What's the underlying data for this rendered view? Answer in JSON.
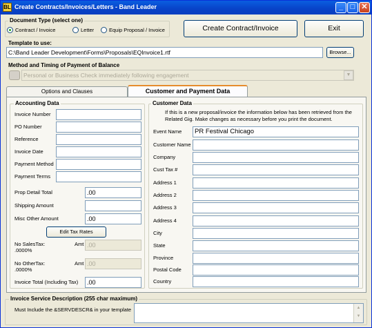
{
  "window": {
    "title": "Create Contracts/Invoices/Letters - Band Leader",
    "min": "_",
    "max": "□",
    "close": "✕"
  },
  "doc_type": {
    "label": "Document Type (select one)",
    "options": [
      "Contract / Invoice",
      "Letter",
      "Equip Proposal / Invoice"
    ],
    "selected": "Contract / Invoice"
  },
  "buttons": {
    "create": "Create Contract/Invoice",
    "exit": "Exit",
    "browse": "Browse...",
    "edit_tax": "Edit Tax Rates"
  },
  "template": {
    "label": "Template to use:",
    "value": "C:\\Band Leader Development\\Forms\\Proposals\\EQInvoice1.rtf"
  },
  "payment_method": {
    "label": "Method and Timing of Payment of Balance",
    "value": "Personal or Business Check immediately following engagement"
  },
  "tabs": [
    "Options and Clauses",
    "Customer and Payment Data"
  ],
  "accounting": {
    "title": "Accounting Data",
    "fields": [
      {
        "label": "Invoice Number",
        "value": ""
      },
      {
        "label": "PO Number",
        "value": ""
      },
      {
        "label": "Reference",
        "value": ""
      },
      {
        "label": "Invoice Date",
        "value": ""
      },
      {
        "label": "Payment Method",
        "value": ""
      },
      {
        "label": "Payment Terms",
        "value": ""
      }
    ],
    "amounts": [
      {
        "label": "Prop Detail Total",
        "value": ".00"
      },
      {
        "label": "Shipping Amount",
        "value": ""
      },
      {
        "label": "Misc Other Amount",
        "value": ".00"
      }
    ],
    "no_sales_tax": {
      "label1": "No SalesTax:",
      "label2": ".0000%",
      "amt_label": "Amt",
      "value": ".00"
    },
    "no_other_tax": {
      "label1": "No OtherTax:",
      "label2": ".0000%",
      "amt_label": "Amt",
      "value": ".00"
    },
    "invoice_total": {
      "label": "Invoice Total (Including Tax)",
      "value": ".00"
    }
  },
  "customer": {
    "title": "Customer Data",
    "note": "If this is a new proposal/invoice the information below has been retrieved from the Related Gig. Make changes as necessary before you print the document.",
    "fields": [
      {
        "label": "Event Name",
        "value": "PR Festival Chicago"
      },
      {
        "label": "Customer Name",
        "value": ""
      },
      {
        "label": "Company",
        "value": ""
      },
      {
        "label": "Cust Tax #",
        "value": ""
      },
      {
        "label": "Address 1",
        "value": ""
      },
      {
        "label": "Address 2",
        "value": ""
      },
      {
        "label": "Address 3",
        "value": ""
      },
      {
        "label": "Address 4",
        "value": ""
      },
      {
        "label": "City",
        "value": ""
      },
      {
        "label": "State",
        "value": ""
      },
      {
        "label": "Province",
        "value": ""
      },
      {
        "label": "Postal Code",
        "value": ""
      },
      {
        "label": "Country",
        "value": ""
      }
    ]
  },
  "service": {
    "title": "Invoice Service Description (255 char maximum)",
    "note": "Must Include the &SERVDESCR& in your template",
    "value": ""
  }
}
